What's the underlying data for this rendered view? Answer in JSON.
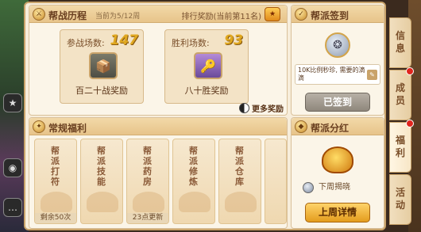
{
  "battle": {
    "title": "帮战历程",
    "period": "当前为5/12周",
    "rank_link": "排行奖励(当前第11名)",
    "battles": {
      "label": "参战场数:",
      "value": "147",
      "reward": "百二十战奖励"
    },
    "wins": {
      "label": "胜利场数:",
      "value": "93",
      "reward": "八十胜奖励"
    },
    "more": "更多奖励"
  },
  "welfare": {
    "title": "常规福利",
    "items": [
      {
        "name": "帮派打符",
        "footer": "剩余50次"
      },
      {
        "name": "帮派技能",
        "footer": ""
      },
      {
        "name": "帮派药房",
        "footer": "23点更新"
      },
      {
        "name": "帮派修炼",
        "footer": ""
      },
      {
        "name": "帮派仓库",
        "footer": ""
      }
    ]
  },
  "sign": {
    "title": "帮派签到",
    "note": "10K比例秒珍, 需要的滴滴",
    "button": "已签到"
  },
  "bonus": {
    "title": "帮派分红",
    "pill": "下周揭晓",
    "button": "上周详情"
  },
  "tabs": [
    {
      "label": "信息",
      "badge": false
    },
    {
      "label": "成员",
      "badge": true
    },
    {
      "label": "福利",
      "badge": true
    },
    {
      "label": "活动",
      "badge": false
    }
  ],
  "colors": {
    "accent_gold": "#e0a820",
    "badge_red": "#e0251d",
    "frame": "#c9a36a"
  }
}
